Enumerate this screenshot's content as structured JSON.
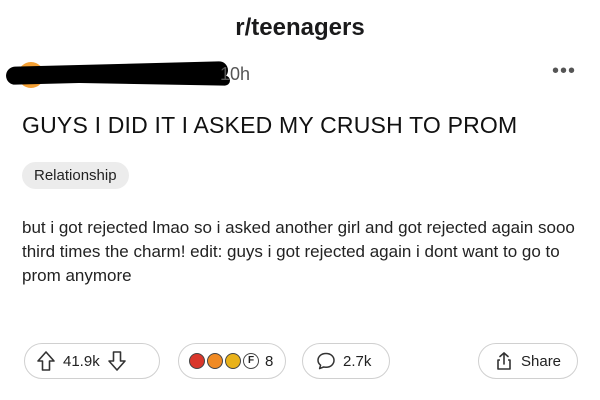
{
  "post": {
    "subreddit": "r/teenagers",
    "timestamp": "10h",
    "title": "GUYS I DID IT I ASKED MY CRUSH TO PROM",
    "flair": "Relationship",
    "body": "but i got rejected lmao so i asked another girl and got rejected again sooo third times the charm! edit: guys i got rejected again i dont want to go to prom anymore"
  },
  "actions": {
    "upvotes": "41.9k",
    "awards": "8",
    "comments": "2.7k",
    "share_label": "Share"
  },
  "icons": {
    "more": "more-icon",
    "upvote": "upvote-icon",
    "downvote": "downvote-icon",
    "comment": "comment-icon",
    "share": "share-icon"
  },
  "colors": {
    "avatar": "#f4a034",
    "award_red": "#d9362b",
    "award_orange": "#f08a24",
    "award_gold": "#e9b21a"
  }
}
